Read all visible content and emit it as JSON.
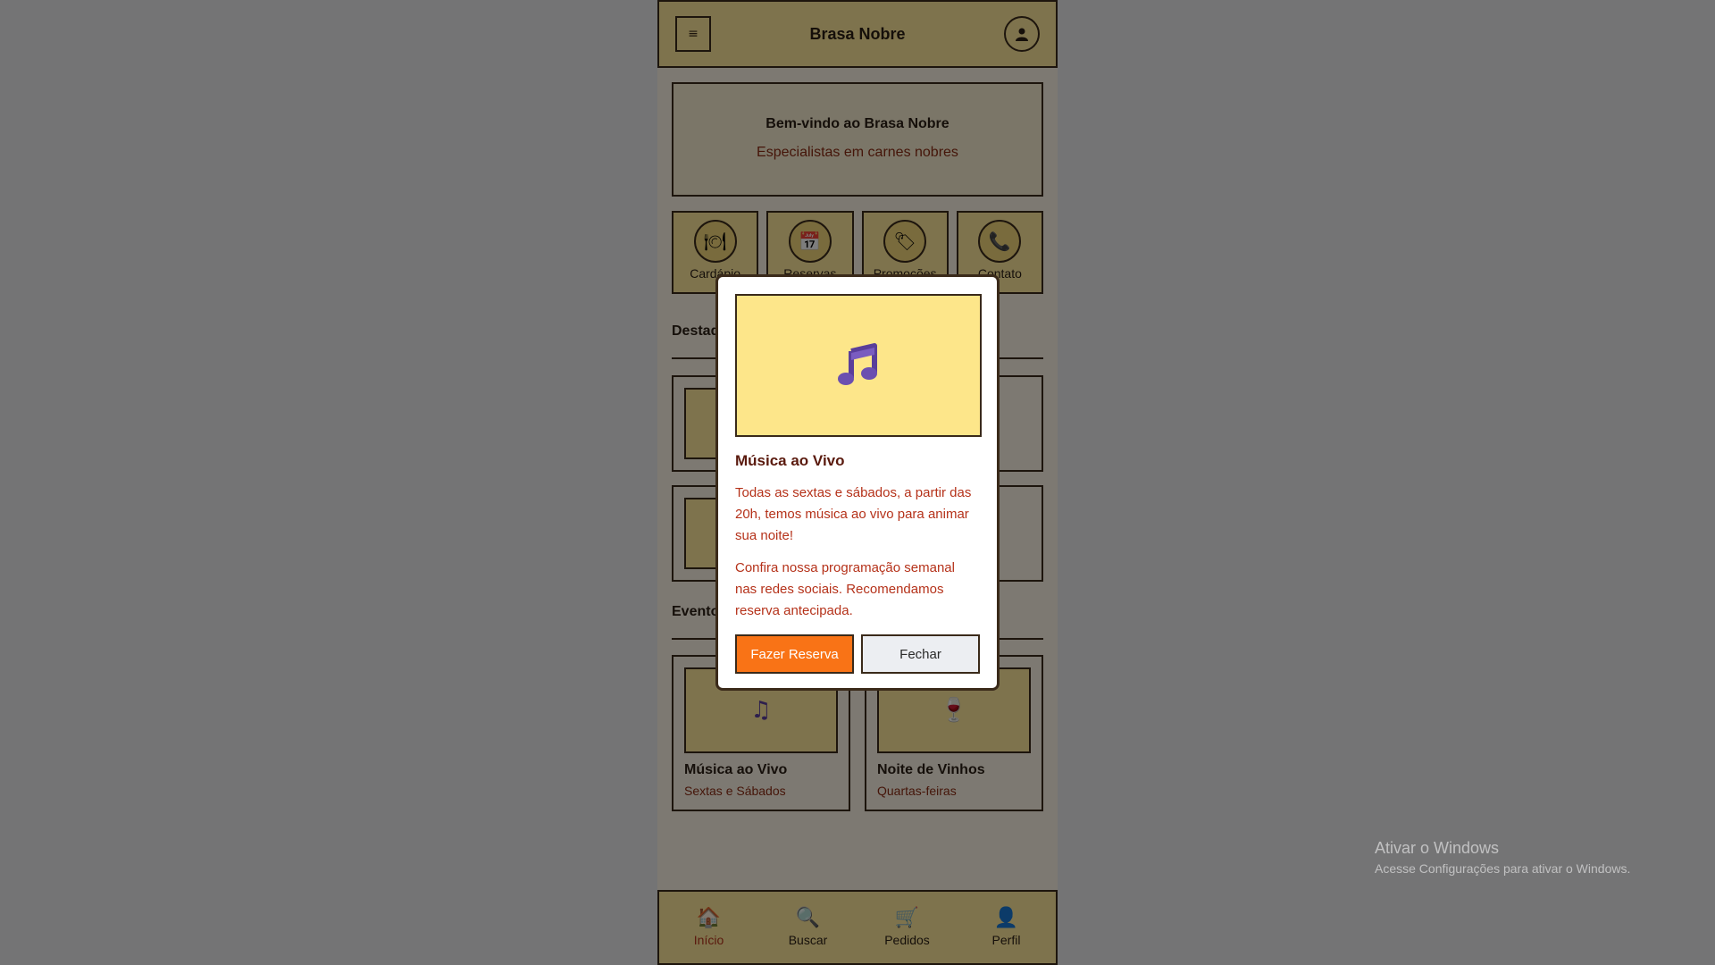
{
  "header": {
    "menu_icon": "≡",
    "title": "Brasa Nobre"
  },
  "welcome": {
    "title": "Bem-vindo ao Brasa Nobre",
    "subtitle": "Especialistas em carnes nobres"
  },
  "quick_actions": [
    {
      "label": "Cardápio",
      "icon": "menu-icon"
    },
    {
      "label": "Reservas",
      "icon": "calendar-icon"
    },
    {
      "label": "Promoções",
      "icon": "tag-icon"
    },
    {
      "label": "Contato",
      "icon": "phone-icon"
    }
  ],
  "sections": {
    "featured_title": "Destaques",
    "events_title": "Eventos"
  },
  "events": [
    {
      "name": "Música ao Vivo",
      "schedule": "Sextas e Sábados",
      "icon": "♫"
    },
    {
      "name": "Noite de Vinhos",
      "schedule": "Quartas-feiras",
      "icon": "🍷"
    }
  ],
  "bottom_nav": [
    {
      "label": "Início",
      "icon": "🏠",
      "active": true
    },
    {
      "label": "Buscar",
      "icon": "🔍"
    },
    {
      "label": "Pedidos",
      "icon": "🛒"
    },
    {
      "label": "Perfil",
      "icon": "👤"
    }
  ],
  "modal": {
    "title": "Música ao Vivo",
    "paragraph1": "Todas as sextas e sábados, a partir das 20h, temos música ao vivo para animar sua noite!",
    "paragraph2": "Confira nossa programação semanal nas redes sociais. Recomendamos reserva antecipada.",
    "primary_label": "Fazer Reserva",
    "secondary_label": "Fechar"
  },
  "watermark": {
    "title": "Ativar o Windows",
    "subtitle": "Acesse Configurações para ativar o Windows."
  }
}
